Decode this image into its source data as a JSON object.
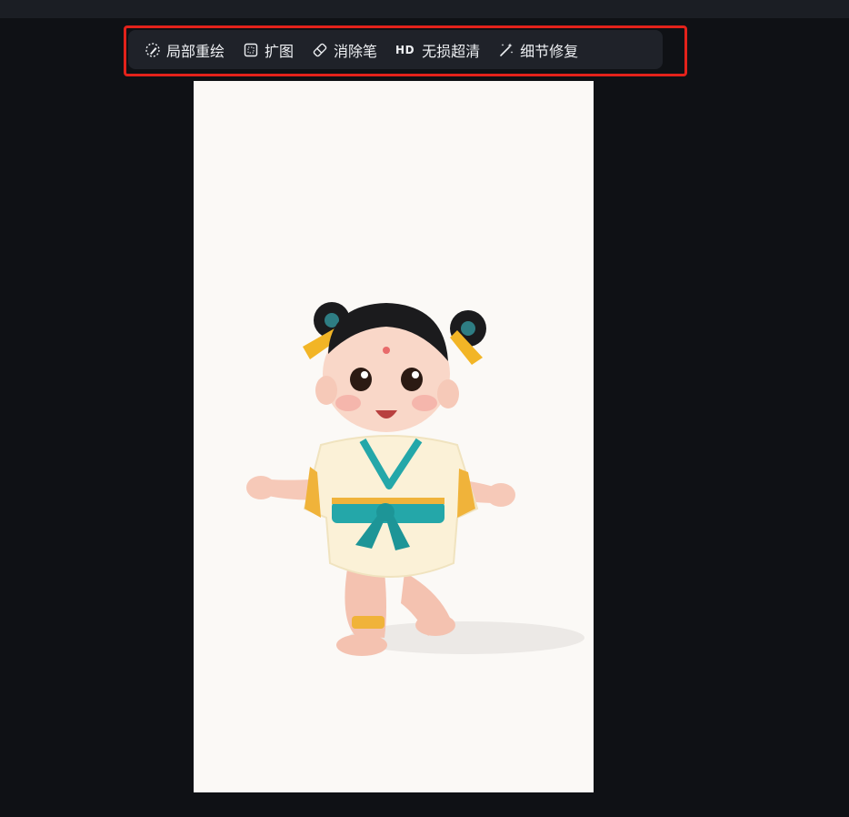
{
  "toolbar": {
    "items": [
      {
        "label": "局部重绘",
        "icon": "brush-circle-icon"
      },
      {
        "label": "扩图",
        "icon": "expand-frame-icon"
      },
      {
        "label": "消除笔",
        "icon": "eraser-icon"
      },
      {
        "label": "无损超清",
        "icon": "hd-icon",
        "icon_text": "HD"
      },
      {
        "label": "细节修复",
        "icon": "magic-wand-icon"
      }
    ]
  },
  "colors": {
    "background": "#0f1115",
    "toolbar_bg": "#1f2229",
    "highlight_border": "#e3221b",
    "canvas_bg": "#fbf9f6"
  }
}
